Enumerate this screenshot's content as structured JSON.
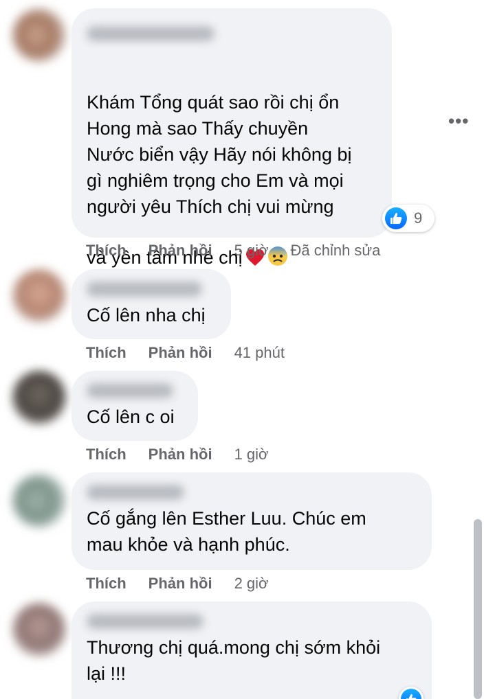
{
  "comments": [
    {
      "text": "Khám Tổng quát sao rồi chị ổn\nHong mà sao Thấy chuyền\nNước biển vậy Hãy nói không bị\ngì nghiêm trọng cho Em và mọi\nngười yêu Thích chị vui mừng\nvà yên tâm nhé chị",
      "emojis": [
        "❤",
        "😰"
      ],
      "like_label": "Thích",
      "reply_label": "Phản hồi",
      "time": "5 giờ",
      "edited": "Đã chỉnh sửa",
      "reaction_count": "9"
    },
    {
      "text": "Cố lên nha chị",
      "like_label": "Thích",
      "reply_label": "Phản hồi",
      "time": "41 phút"
    },
    {
      "text": "Cố lên c oi",
      "like_label": "Thích",
      "reply_label": "Phản hồi",
      "time": "1 giờ"
    },
    {
      "text": "Cố gắng lên Esther Luu. Chúc em\nmau khỏe và hạnh phúc.",
      "like_label": "Thích",
      "reply_label": "Phản hồi",
      "time": "2 giờ"
    },
    {
      "text": "Thương chị quá.mong chị sớm khỏi\nlại !!!"
    }
  ],
  "more_label": "•••",
  "icons": {
    "reaction": "like-icon",
    "more": "more-options-icon"
  },
  "colors": {
    "bubble": "#f0f2f5",
    "meta_text": "#65676b",
    "text": "#050505",
    "like_blue": "#0866ff"
  }
}
